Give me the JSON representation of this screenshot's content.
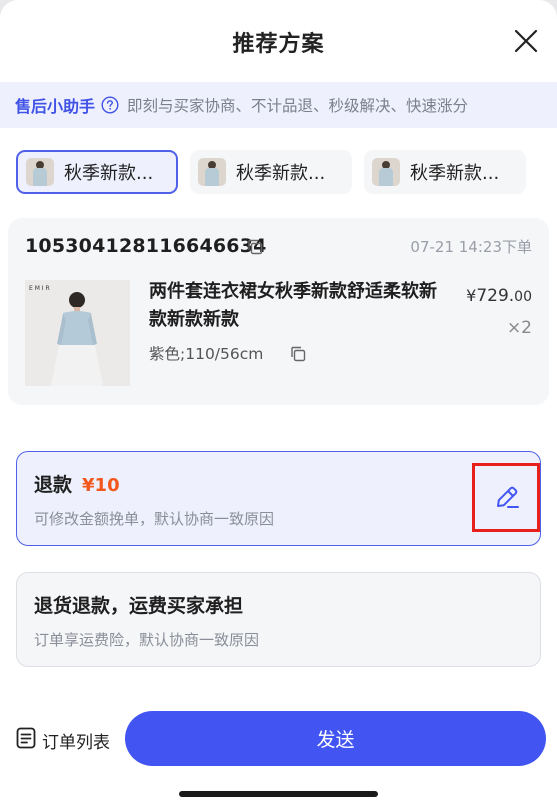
{
  "header": {
    "title": "推荐方案",
    "close_icon": "close-icon"
  },
  "helper": {
    "title": "售后小助手",
    "icon": "question-circle-icon",
    "description": "即刻与买家协商、不计品退、秒级解决、快速涨分"
  },
  "tabs": [
    {
      "label": "秋季新款...",
      "active": true
    },
    {
      "label": "秋季新款...",
      "active": false
    },
    {
      "label": "秋季新款...",
      "active": false
    }
  ],
  "order": {
    "number": "105304128116646634",
    "time": "07-21 14:23下单",
    "product": {
      "name": "两件套连衣裙女秋季新款舒适柔软新款新款新款",
      "sku": "紫色;110/56cm",
      "price_symbol": "¥",
      "price_int": "729.",
      "price_dec": "00",
      "quantity": "×2"
    }
  },
  "options": [
    {
      "title": "退款",
      "amount": "¥10",
      "subtitle": "可修改金额挽单，默认协商一致原因",
      "selected": true,
      "edit_icon": "pencil-icon"
    },
    {
      "title": "退货退款，运费买家承担",
      "subtitle": "订单享运费险，默认协商一致原因",
      "selected": false
    }
  ],
  "bottom": {
    "orders_label": "订单列表",
    "orders_icon": "list-icon",
    "send_label": "发送"
  },
  "colors": {
    "accent": "#4255f2",
    "accent_light": "#eef1fd",
    "price_orange": "#f2571d",
    "highlight_red": "#e8201c"
  }
}
